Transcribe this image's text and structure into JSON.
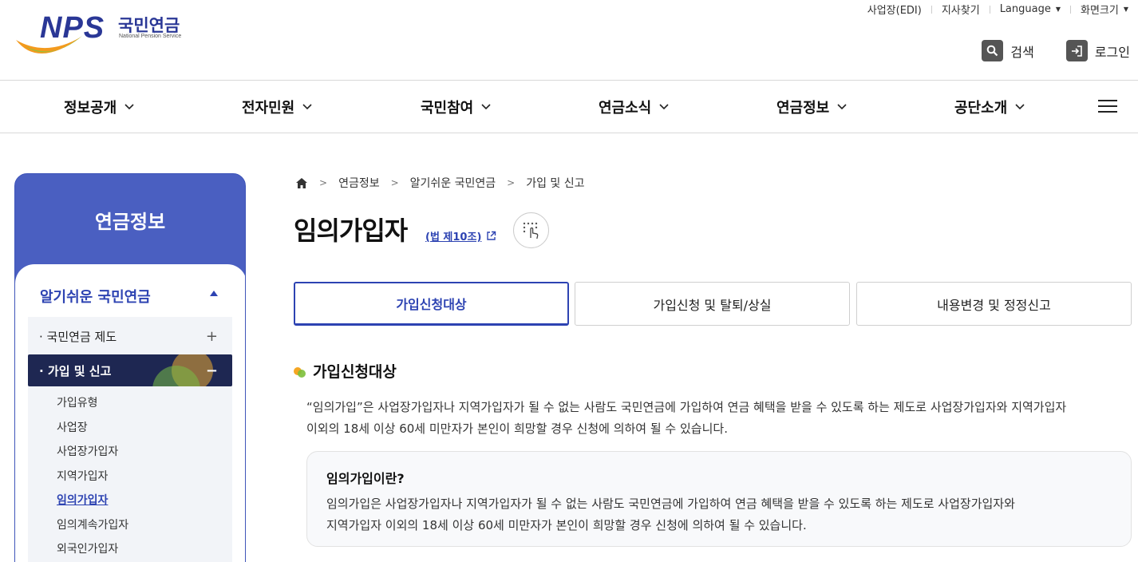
{
  "brand": {
    "logo_text": "NPS",
    "name_kr": "국민연금",
    "name_en": "National Pension Service"
  },
  "utility_nav": [
    {
      "label": "사업장(EDI)"
    },
    {
      "label": "지사찾기"
    },
    {
      "label": "Language"
    },
    {
      "label": "화면크기"
    }
  ],
  "actions": {
    "search_label": "검색",
    "login_label": "로그인"
  },
  "gnb": [
    "정보공개",
    "전자민원",
    "국민참여",
    "연금소식",
    "연금정보",
    "공단소개"
  ],
  "lnb": {
    "title": "연금정보",
    "section": "알기쉬운 국민연금",
    "depth1": [
      {
        "label": "국민연금 제도",
        "toggle": "+"
      },
      {
        "label": "가입 및 신고",
        "toggle": "−"
      }
    ],
    "depth2": [
      "가입유형",
      "사업장",
      "사업장가입자",
      "지역가입자",
      "임의가입자",
      "임의계속가입자",
      "외국인가입자"
    ]
  },
  "breadcrumb": [
    "연금정보",
    "알기쉬운 국민연금",
    "가입 및 신고"
  ],
  "page": {
    "title": "임의가입자",
    "law_link": "(법 제10조)",
    "tabs": [
      "가입신청대상",
      "가입신청 및 탈퇴/상실",
      "내용변경 및 정정신고"
    ],
    "section_title": "가입신청대상",
    "intro_line1": "“임의가입”은 사업장가입자나 지역가입자가 될 수 없는 사람도 국민연금에 가입하여 연금 혜택을 받을 수 있도록 하는 제도로 사업장가입자와 지역가입자",
    "intro_line2": "이외의 18세 이상 60세 미만자가 본인이 희망할 경우 신청에 의하여 될 수 있습니다.",
    "box_title": "임의가입이란?",
    "box_line1": "임의가입은 사업장가입자나 지역가입자가 될 수 없는 사람도 국민연금에 가입하여 연금 혜택을 받을 수 있도록 하는 제도로 사업장가입자와",
    "box_line2": "지역가입자 이외의 18세 이상 60세 미만자가 본인이 희망할 경우 신청에 의하여 될 수 있습니다."
  },
  "colors": {
    "brand_blue": "#2d43b2",
    "nav_active": "#1e2752",
    "lnb_header": "#4a5fc1"
  }
}
